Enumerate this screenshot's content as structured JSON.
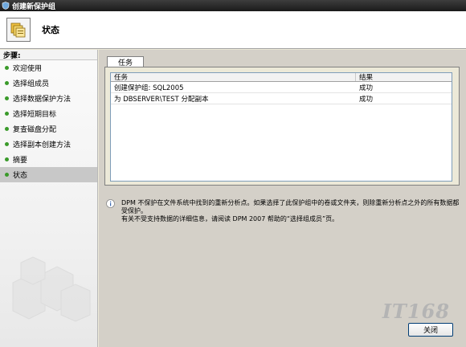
{
  "window": {
    "title": "创建新保护组"
  },
  "header": {
    "title": "状态",
    "icon": "protection-group-icon"
  },
  "steps": {
    "label": "步骤:",
    "items": [
      {
        "label": "欢迎使用",
        "active": false
      },
      {
        "label": "选择组成员",
        "active": false
      },
      {
        "label": "选择数据保护方法",
        "active": false
      },
      {
        "label": "选择短期目标",
        "active": false
      },
      {
        "label": "复查磁盘分配",
        "active": false
      },
      {
        "label": "选择副本创建方法",
        "active": false
      },
      {
        "label": "摘要",
        "active": false
      },
      {
        "label": "状态",
        "active": true
      }
    ]
  },
  "tab": {
    "label": "任务"
  },
  "table": {
    "columns": [
      "任务",
      "结果"
    ],
    "rows": [
      {
        "task": "创建保护组: SQL2005",
        "result": "成功"
      },
      {
        "task": "为 DBSERVER\\TEST 分配副本",
        "result": "成功"
      }
    ]
  },
  "info": {
    "line1": "DPM 不保护在文件系统中找到的重新分析点。如果选择了此保护组中的卷或文件夹，则除重新分析点之外的所有数据都受保护。",
    "line2": "有关不受支持数据的详细信息，请阅读 DPM 2007 帮助的“选择组成员”页。"
  },
  "watermark": {
    "text": "IT168"
  },
  "buttons": {
    "close": "关闭"
  },
  "colors": {
    "titlebar": "#1a1a1a",
    "step_bullet": "#3a9a2a",
    "active_step": "#c8c8c8",
    "button_border": "#003c74"
  }
}
